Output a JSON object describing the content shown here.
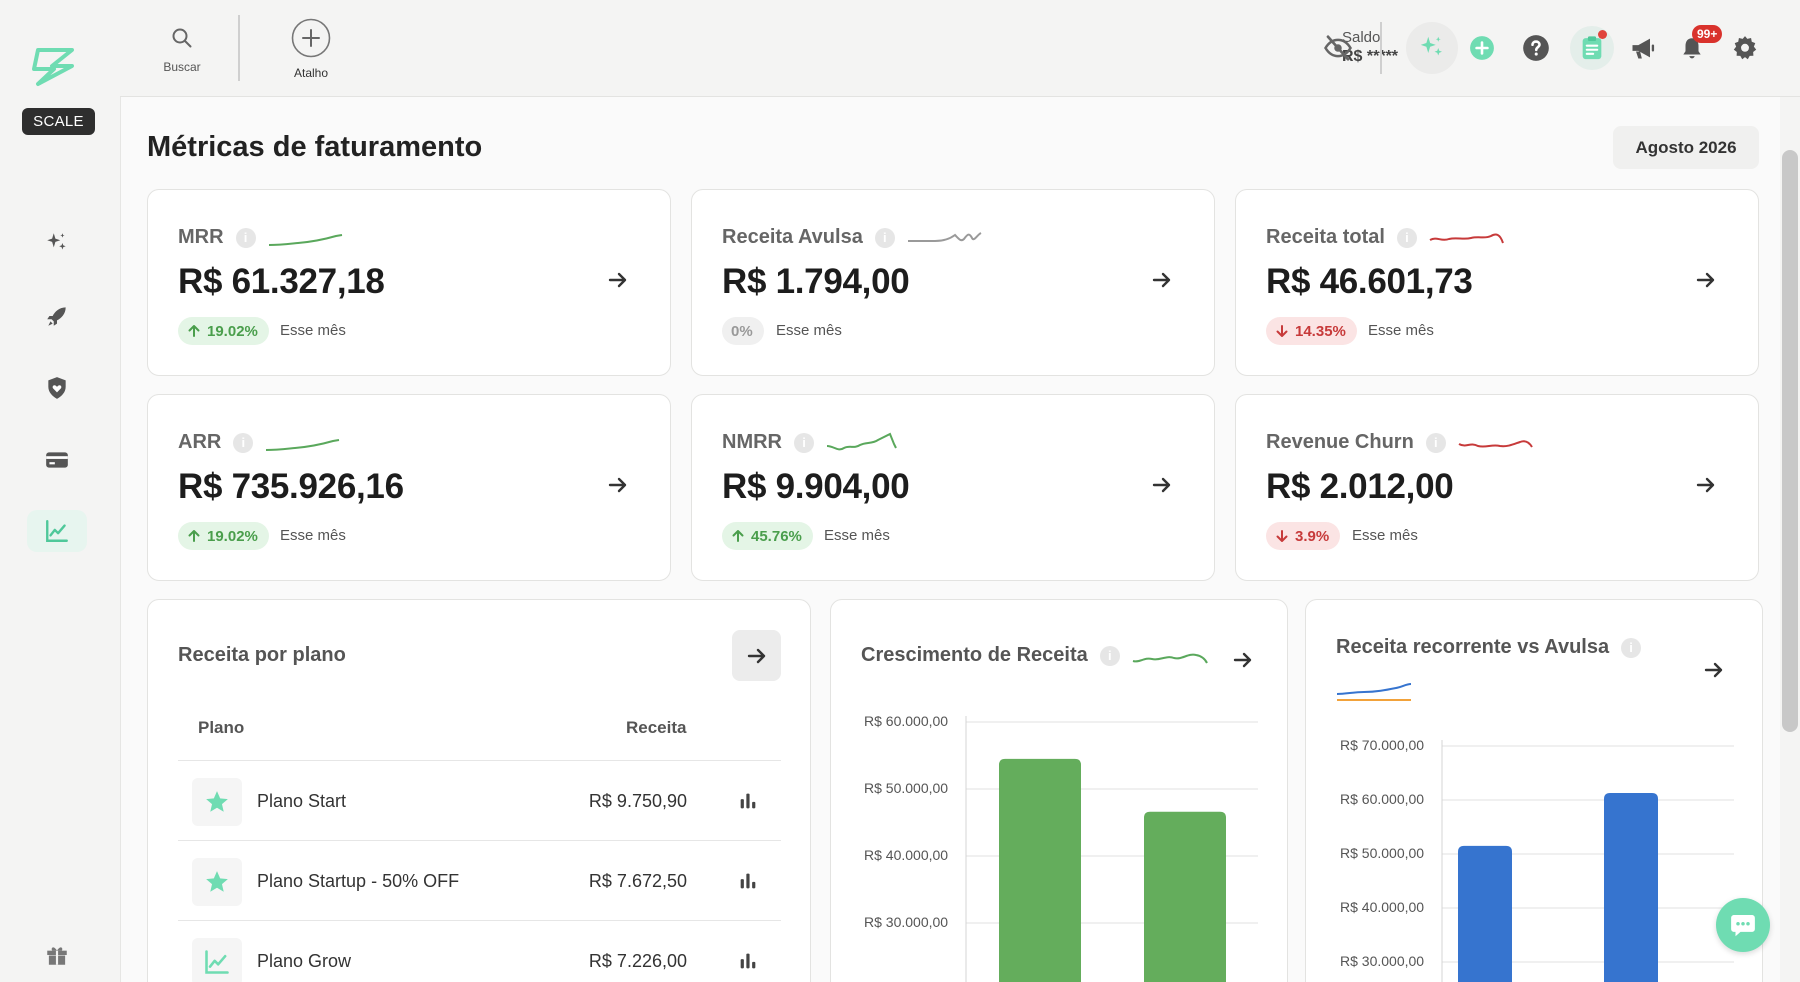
{
  "sidebar": {
    "plan_badge": "SCALE"
  },
  "topbar": {
    "search_label": "Buscar",
    "shortcut_label": "Atalho",
    "balance_label": "Saldo",
    "balance_value": "R$ *****",
    "notification_count": "99+"
  },
  "page": {
    "title": "Métricas de faturamento",
    "month": "Agosto 2026"
  },
  "metrics": [
    {
      "title": "MRR",
      "value": "R$ 61.327,18",
      "change": "19.02%",
      "trend": "up",
      "period": "Esse mês",
      "spark_color": "#5aa85c"
    },
    {
      "title": "Receita Avulsa",
      "value": "R$ 1.794,00",
      "change": "0%",
      "trend": "neutral",
      "period": "Esse mês",
      "spark_color": "#9a9a9a"
    },
    {
      "title": "Receita total",
      "value": "R$ 46.601,73",
      "change": "14.35%",
      "trend": "down",
      "period": "Esse mês",
      "spark_color": "#c73a3a"
    },
    {
      "title": "ARR",
      "value": "R$ 735.926,16",
      "change": "19.02%",
      "trend": "up",
      "period": "Esse mês",
      "spark_color": "#5aa85c"
    },
    {
      "title": "NMRR",
      "value": "R$ 9.904,00",
      "change": "45.76%",
      "trend": "up",
      "period": "Esse mês",
      "spark_color": "#5aa85c"
    },
    {
      "title": "Revenue Churn",
      "value": "R$ 2.012,00",
      "change": "3.9%",
      "trend": "down",
      "period": "Esse mês",
      "spark_color": "#c73a3a"
    }
  ],
  "plans": {
    "title": "Receita por plano",
    "col_plan": "Plano",
    "col_revenue": "Receita",
    "rows": [
      {
        "name": "Plano Start",
        "revenue": "R$ 9.750,90",
        "icon": "star-icon"
      },
      {
        "name": "Plano Startup - 50% OFF",
        "revenue": "R$ 7.672,50",
        "icon": "star-icon"
      },
      {
        "name": "Plano Grow",
        "revenue": "R$ 7.226,00",
        "icon": "chart-line-icon"
      }
    ]
  },
  "growth": {
    "title": "Crescimento de Receita",
    "yticks": [
      "R$ 60.000,00",
      "R$ 50.000,00",
      "R$ 40.000,00",
      "R$ 30.000,00"
    ]
  },
  "recurring": {
    "title": "Receita recorrente vs Avulsa",
    "yticks": [
      "R$ 70.000,00",
      "R$ 60.000,00",
      "R$ 50.000,00",
      "R$ 40.000,00",
      "R$ 30.000,00"
    ]
  },
  "chart_data": [
    {
      "type": "bar",
      "title": "Crescimento de Receita",
      "categories": [
        "",
        ""
      ],
      "values": [
        54500,
        46600
      ],
      "ylim": [
        20000,
        60000
      ],
      "color": "#64ad5c",
      "grid": true
    },
    {
      "type": "bar",
      "title": "Receita recorrente vs Avulsa",
      "categories": [
        "",
        ""
      ],
      "values": [
        51500,
        61300
      ],
      "ylim": [
        20000,
        70000
      ],
      "color": "#3674cf",
      "grid": true
    }
  ]
}
